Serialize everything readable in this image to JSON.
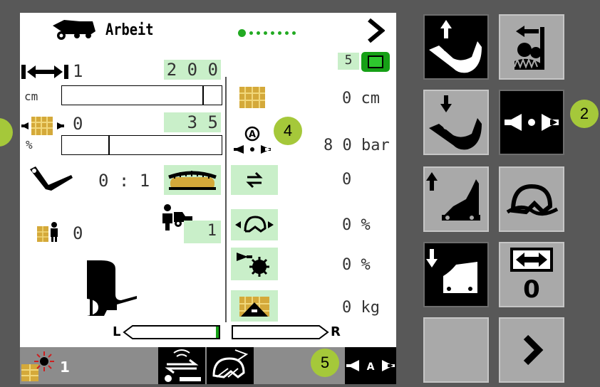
{
  "header": {
    "title": "Arbeit"
  },
  "pager": {
    "total": 8,
    "active": 0
  },
  "left": {
    "length_setpoint": "1",
    "length_value": "2 0 0",
    "length_unit": "cm",
    "length_bar_fill": 0.88,
    "pressure_setpoint": "0",
    "pressure_value": "3 5",
    "pressure_unit": "%",
    "pressure_bar_fill": 0.29,
    "knife_ratio": "0 : 1",
    "bale_counter": "0",
    "operator_number": "1"
  },
  "right": {
    "terminal_number": "5",
    "bale_length": "0 cm",
    "pressure": "8 0 bar",
    "counter": "0",
    "percent_1": "0 %",
    "percent_2": "0 %",
    "weight": "0 kg"
  },
  "balance": {
    "left_label": "L",
    "right_label": "R"
  },
  "bottom": {
    "light_count": "1"
  },
  "badges": {
    "b2": "2",
    "b4": "4",
    "b5": "5"
  },
  "colors": {
    "accent_green": "#c9efc9",
    "badge": "#a5c83a",
    "pager_active": "#22aa22"
  }
}
